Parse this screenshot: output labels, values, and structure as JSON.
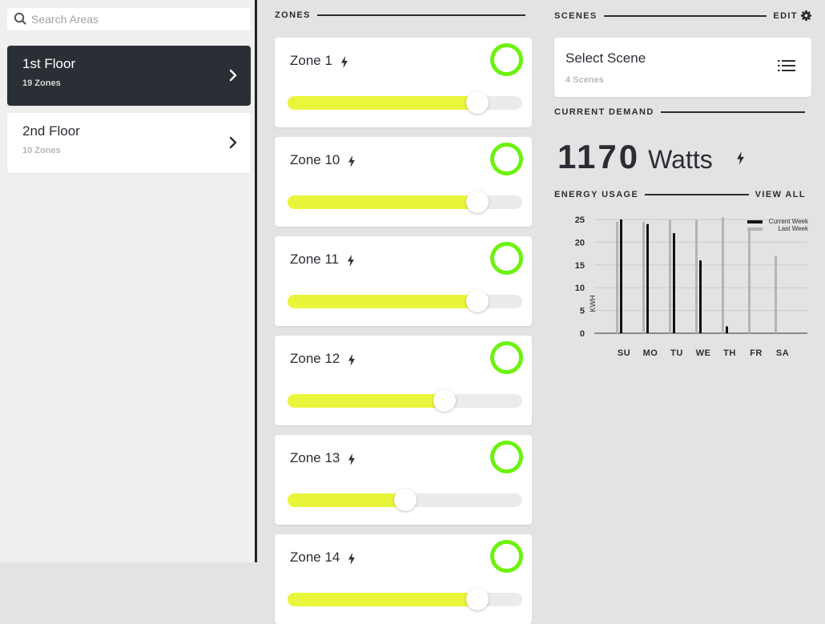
{
  "search": {
    "placeholder": "Search Areas"
  },
  "areas": [
    {
      "name": "1st Floor",
      "count": "19 Zones",
      "active": true
    },
    {
      "name": "2nd Floor",
      "count": "10 Zones",
      "active": false
    }
  ],
  "zones_header": "ZONES",
  "zones": [
    {
      "name": "Zone 1",
      "level": 0.81
    },
    {
      "name": "Zone 10",
      "level": 0.81
    },
    {
      "name": "Zone 11",
      "level": 0.81
    },
    {
      "name": "Zone 12",
      "level": 0.67
    },
    {
      "name": "Zone 13",
      "level": 0.5
    },
    {
      "name": "Zone 14",
      "level": 0.81
    }
  ],
  "scenes": {
    "header": "SCENES",
    "edit_label": "EDIT",
    "select_label": "Select Scene",
    "count": "4 Scenes"
  },
  "demand": {
    "header": "CURRENT DEMAND",
    "value": "1170",
    "unit": "Watts"
  },
  "energy": {
    "header": "ENERGY USAGE",
    "view_all": "VIEW ALL"
  },
  "colors": {
    "accent_green": "#6cf20e",
    "slider_yellow": "#e9f53a",
    "dark": "#2a2e35"
  },
  "chart_data": {
    "type": "bar",
    "categories": [
      "SU",
      "MO",
      "TU",
      "WE",
      "TH",
      "FR",
      "SA"
    ],
    "ylabel": "KWH",
    "ylim": [
      0,
      25
    ],
    "yticks": [
      0,
      5,
      10,
      15,
      20,
      25
    ],
    "legend_position": "top-right",
    "series": [
      {
        "name": "Current Week",
        "color": "#111111",
        "values": [
          25,
          24,
          22,
          16,
          1.5,
          0,
          0
        ]
      },
      {
        "name": "Last Week",
        "color": "#b4b4b4",
        "values": [
          24.5,
          24.5,
          25,
          25,
          25.5,
          23,
          17
        ]
      }
    ]
  }
}
